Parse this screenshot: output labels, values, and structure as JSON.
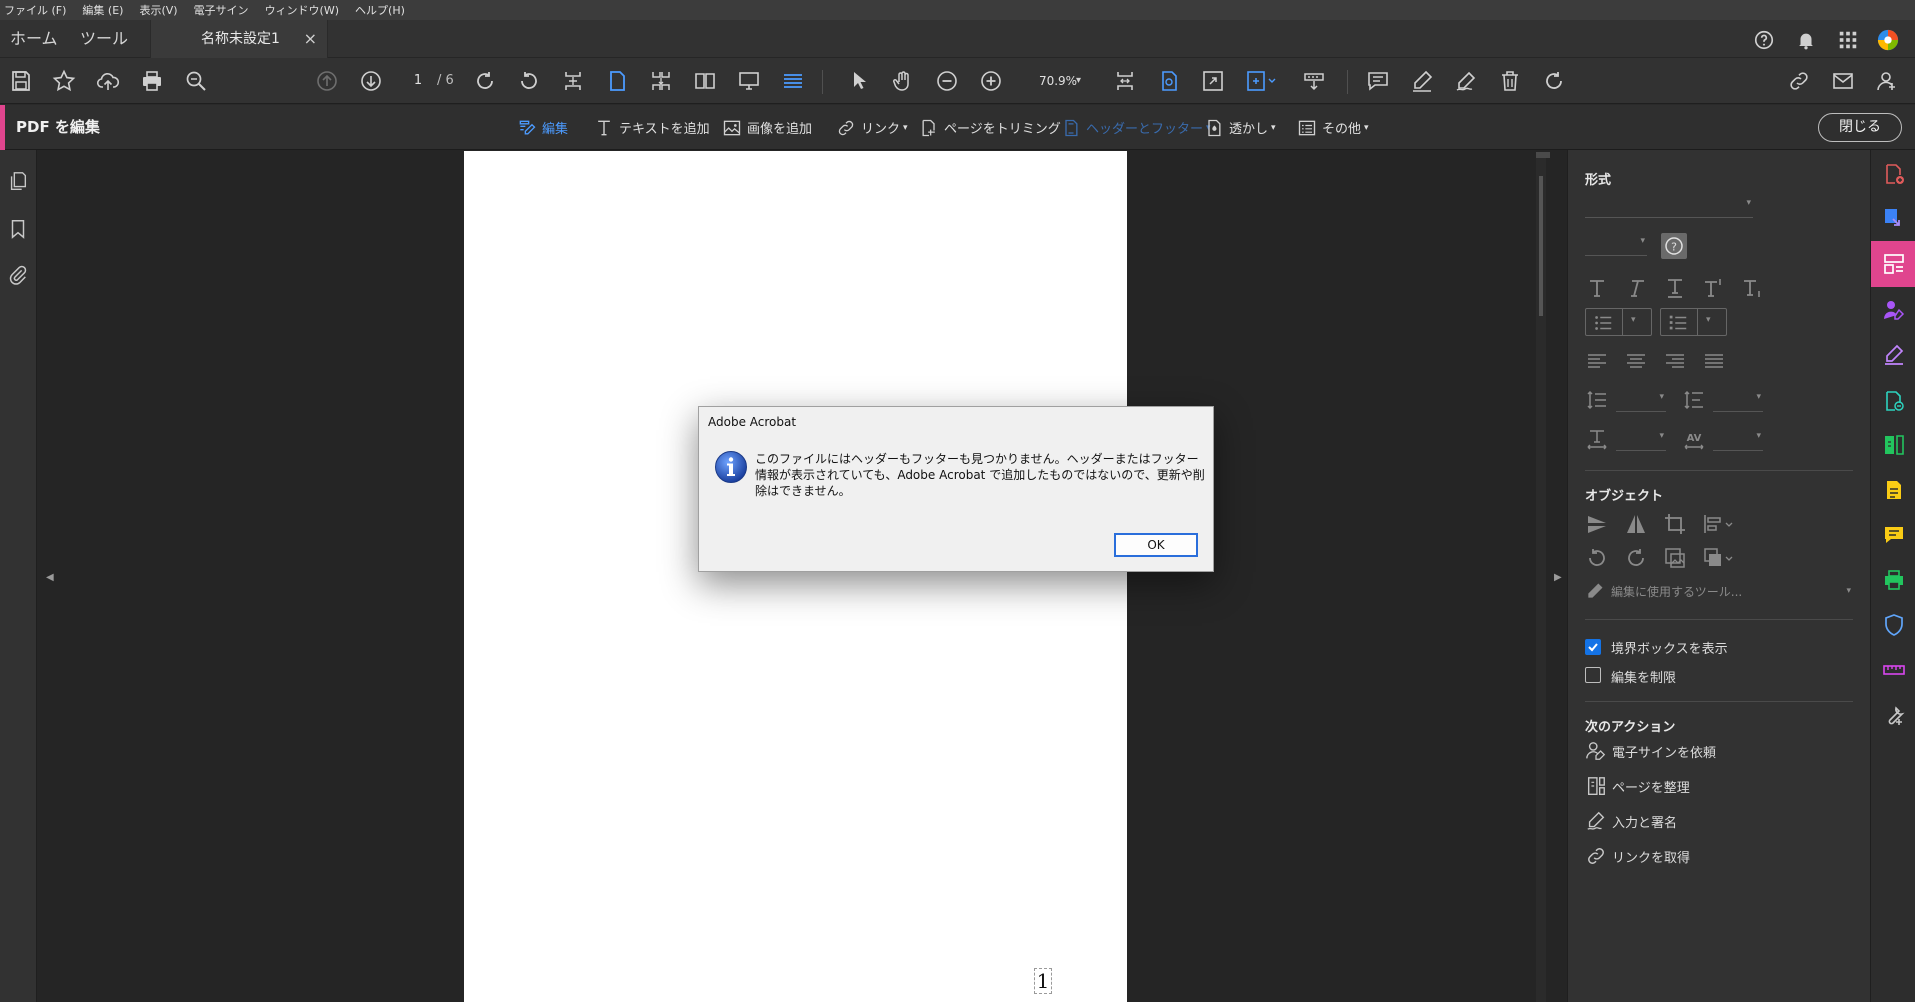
{
  "menu": [
    "ファイル (F)",
    "編集 (E)",
    "表示(V)",
    "電子サイン",
    "ウィンドウ(W)",
    "ヘルプ(H)"
  ],
  "tabs": {
    "home": "ホーム",
    "tools": "ツール",
    "doc": "名称未設定1",
    "close": "×"
  },
  "toolbar": {
    "page_current": "1",
    "page_total": "/ 6",
    "zoom": "70.9%"
  },
  "edit_bar": {
    "title": "PDF を編集",
    "edit": "編集",
    "add_text": "テキストを追加",
    "add_image": "画像を追加",
    "link": "リンク",
    "crop": "ページをトリミング",
    "header_footer": "ヘッダーとフッター",
    "watermark": "透かし",
    "more": "その他",
    "close": "閉じる"
  },
  "page": {
    "footer_number": "1"
  },
  "format_panel": {
    "format_heading": "形式",
    "object_heading": "オブジェクト",
    "edit_tool_placeholder": "編集に使用するツール...",
    "show_bounding_boxes": "境界ボックスを表示",
    "restrict_editing": "編集を制限",
    "next_actions_heading": "次のアクション",
    "actions": [
      "電子サインを依頼",
      "ページを整理",
      "入力と署名",
      "リンクを取得"
    ]
  },
  "dialog": {
    "title": "Adobe Acrobat",
    "message": "このファイルにはヘッダーもフッターも見つかりません。ヘッダーまたはフッター情報が表示されていても、Adobe Acrobat で追加したものではないので、更新や削除はできません。",
    "ok": "OK"
  },
  "colors": {
    "accent_pink": "#e0458e",
    "active_blue": "#4c9bff",
    "checkbox_blue": "#1473e6"
  }
}
